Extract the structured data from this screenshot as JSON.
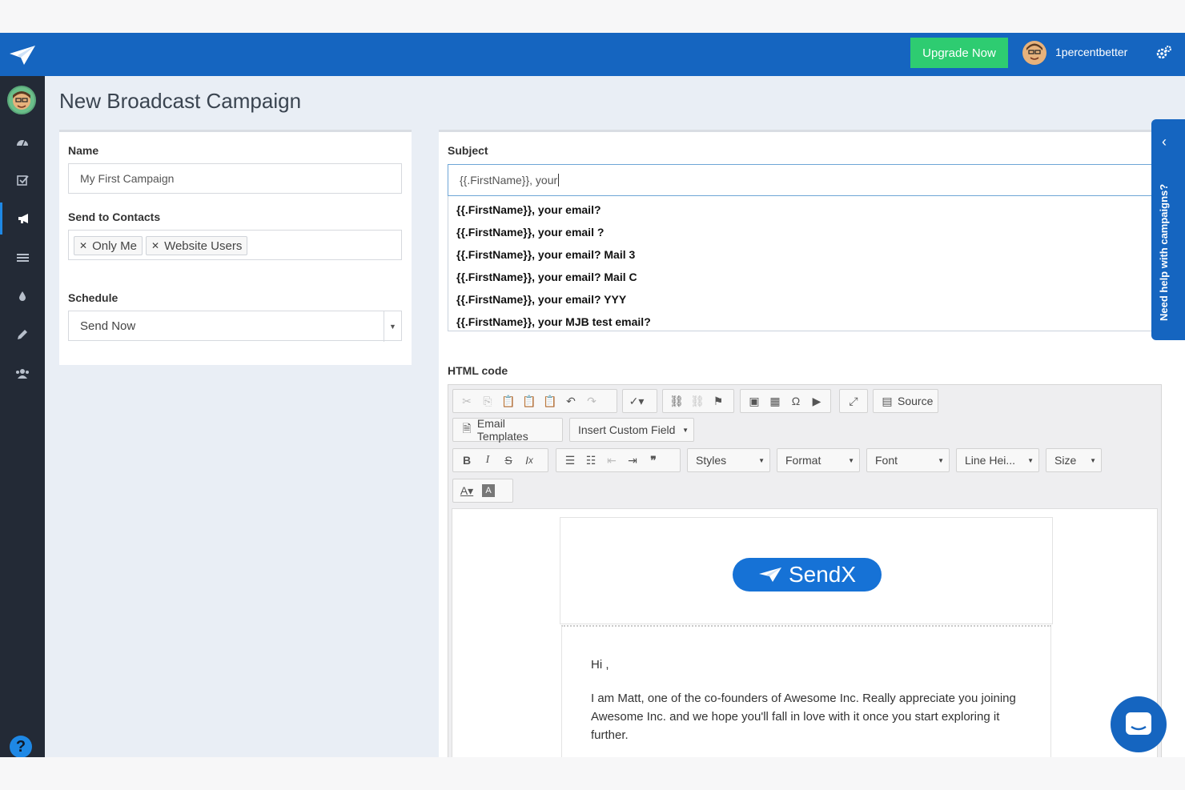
{
  "topbar": {
    "upgrade_label": "Upgrade Now",
    "username": "1percentbetter"
  },
  "sidebar": {
    "items": [
      {
        "name": "dashboard",
        "icon": "dashboard-icon"
      },
      {
        "name": "tasks",
        "icon": "checkbox-icon"
      },
      {
        "name": "campaigns",
        "icon": "megaphone-icon",
        "active": true
      },
      {
        "name": "lists",
        "icon": "list-icon"
      },
      {
        "name": "drip",
        "icon": "drop-icon"
      },
      {
        "name": "design",
        "icon": "pencil-icon"
      },
      {
        "name": "contacts",
        "icon": "users-icon"
      }
    ],
    "help_label": "?"
  },
  "page": {
    "title": "New Broadcast Campaign"
  },
  "form": {
    "name_label": "Name",
    "name_value": "My First Campaign",
    "contacts_label": "Send to Contacts",
    "contacts": [
      "Only Me",
      "Website Users"
    ],
    "schedule_label": "Schedule",
    "schedule_value": "Send Now",
    "subject_label": "Subject",
    "subject_value": "{{.FirstName}}, your",
    "suggestions": [
      "{{.FirstName}}, your email?",
      "{{.FirstName}}, your email ?",
      "{{.FirstName}}, your email? Mail 3",
      "{{.FirstName}}, your email? Mail C",
      "{{.FirstName}}, your email? YYY",
      "{{.FirstName}}, your MJB test email?"
    ],
    "html_label": "HTML code"
  },
  "editor": {
    "source_label": "Source",
    "email_templates_label": "Email Templates",
    "insert_field_label": "Insert Custom Field",
    "styles_label": "Styles",
    "format_label": "Format",
    "font_label": "Font",
    "line_height_label": "Line Hei...",
    "size_label": "Size"
  },
  "email": {
    "brand": "SendX",
    "greeting": "Hi ,",
    "body": "I am Matt, one of the co-founders of Awesome Inc. Really appreciate you joining Awesome Inc. and we hope you'll fall in love with it once you start exploring it further."
  },
  "help_tab": {
    "text": "Need help with campaigns?"
  },
  "colors": {
    "topbar": "#1565c0",
    "upgrade": "#2ecc71",
    "sidebar": "#232a36",
    "brand": "#1672d6"
  }
}
